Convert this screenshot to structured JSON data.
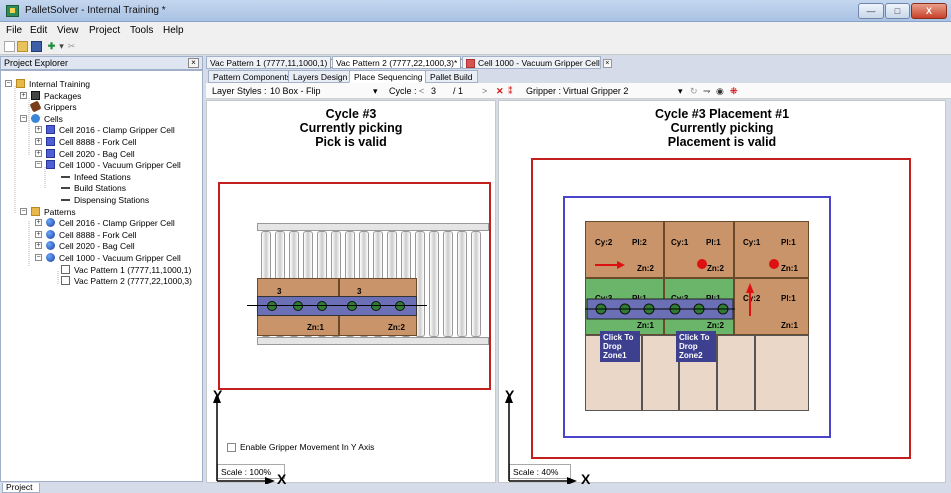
{
  "window": {
    "title": "PalletSolver - Internal Training *",
    "minimize_label": "—",
    "maximize_label": "□",
    "close_label": "X"
  },
  "menu": [
    "File",
    "Edit",
    "View",
    "Project",
    "Tools",
    "Help"
  ],
  "project_explorer": {
    "title": "Project Explorer",
    "close_label": "×",
    "bottom_tab": "Project",
    "tree": [
      {
        "label": "Internal Training",
        "icon": "project-folder-icon",
        "level": 0,
        "expander": "−"
      },
      {
        "label": "Packages",
        "icon": "packages-icon",
        "level": 1,
        "expander": "+"
      },
      {
        "label": "Grippers",
        "icon": "gripper-icon",
        "level": 1,
        "expander": ""
      },
      {
        "label": "Cells",
        "icon": "cells-icon",
        "level": 1,
        "expander": "−"
      },
      {
        "label": "Cell 2016 - Clamp Gripper Cell",
        "icon": "cell-icon",
        "level": 2,
        "expander": "+"
      },
      {
        "label": "Cell 8888 - Fork Cell",
        "icon": "cell-icon",
        "level": 2,
        "expander": "+"
      },
      {
        "label": "Cell 2020 - Bag Cell",
        "icon": "cell-icon",
        "level": 2,
        "expander": "+"
      },
      {
        "label": "Cell 1000 - Vacuum Gripper Cell",
        "icon": "cell-icon",
        "level": 2,
        "expander": "−"
      },
      {
        "label": "Infeed Stations",
        "icon": "station-icon",
        "level": 3,
        "expander": ""
      },
      {
        "label": "Build Stations",
        "icon": "station-icon",
        "level": 3,
        "expander": ""
      },
      {
        "label": "Dispensing Stations",
        "icon": "station-icon",
        "level": 3,
        "expander": ""
      },
      {
        "label": "Patterns",
        "icon": "patterns-folder-icon",
        "level": 1,
        "expander": "−"
      },
      {
        "label": "Cell 2016 - Clamp Gripper Cell",
        "icon": "pattern-cell-icon",
        "level": 2,
        "expander": "+"
      },
      {
        "label": "Cell 8888 - Fork Cell",
        "icon": "pattern-cell-icon",
        "level": 2,
        "expander": "+"
      },
      {
        "label": "Cell 2020 - Bag Cell",
        "icon": "pattern-cell-icon",
        "level": 2,
        "expander": "+"
      },
      {
        "label": "Cell 1000 - Vacuum Gripper Cell",
        "icon": "pattern-cell-icon",
        "level": 2,
        "expander": "−"
      },
      {
        "label": "Vac Pattern 1 (7777,11,1000,1)",
        "icon": "pattern-doc-icon",
        "level": 3,
        "expander": ""
      },
      {
        "label": "Vac Pattern 2 (7777,22,1000,3)",
        "icon": "pattern-doc-icon",
        "level": 3,
        "expander": ""
      }
    ]
  },
  "doc_tabs": [
    {
      "label": "Vac Pattern 1 (7777,11,1000,1)",
      "close": "×"
    },
    {
      "label": "Vac Pattern 2 (7777,22,1000,3)*",
      "close": "×"
    },
    {
      "label": "Cell 1000 - Vacuum Gripper Cell",
      "close": "×"
    }
  ],
  "sub_tabs": [
    "Pattern Components",
    "Layers Design",
    "Place Sequencing",
    "Pallet Build"
  ],
  "layer_bar": {
    "layer_styles_label": "Layer Styles :",
    "layer_styles_value": "10 Box - Flip",
    "cycle_label": "Cycle :",
    "cycle_value": "3",
    "cycle_total": "/ 1",
    "gripper_label": "Gripper :",
    "gripper_value": "Virtual Gripper 2"
  },
  "left_panel": {
    "heading_1": "Cycle #3",
    "heading_2": "Currently picking",
    "heading_3": "Pick is valid",
    "box_1_count": "3",
    "box_2_count": "3",
    "zone_1": "Zn:1",
    "zone_2": "Zn:2",
    "checkbox_label": "Enable Gripper Movement In Y Axis",
    "scale_label": "Scale :",
    "scale_value": "100%",
    "axis_y": "Y",
    "axis_x": "X"
  },
  "right_panel": {
    "heading_1": "Cycle #3 Placement #1",
    "heading_2": "Currently picking",
    "heading_3": "Placement is valid",
    "cells": [
      {
        "cy": "Cy:2",
        "pl": "Pl:2",
        "zn": "Zn:2"
      },
      {
        "cy": "Cy:1",
        "pl": "Pl:1",
        "zn": "Zn:2"
      },
      {
        "cy": "Cy:1",
        "pl": "Pl:1",
        "zn": "Zn:1"
      },
      {
        "cy": "Cy:3",
        "pl": "Pl:1",
        "zn": "Zn:1"
      },
      {
        "cy": "Cy:3",
        "pl": "Pl:1",
        "zn": "Zn:2"
      },
      {
        "cy": "Cy:2",
        "pl": "Pl:1",
        "zn": "Zn:1"
      }
    ],
    "drop_zone_1": "Click To Drop Zone1",
    "drop_zone_2": "Click To Drop Zone2",
    "scale_label": "Scale :",
    "scale_value": "40%",
    "axis_y": "Y",
    "axis_x": "X"
  }
}
